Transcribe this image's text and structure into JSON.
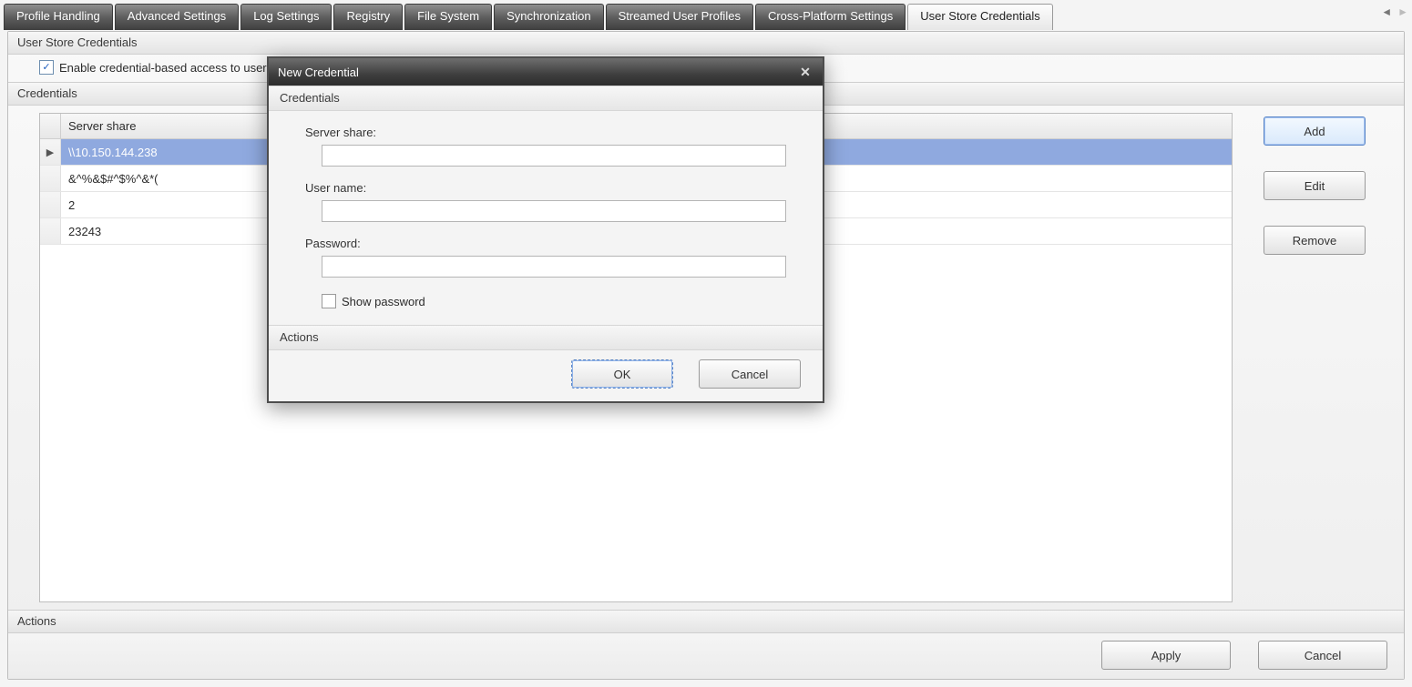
{
  "tabs": [
    {
      "label": "Profile Handling",
      "active": false
    },
    {
      "label": "Advanced Settings",
      "active": false
    },
    {
      "label": "Log Settings",
      "active": false
    },
    {
      "label": "Registry",
      "active": false
    },
    {
      "label": "File System",
      "active": false
    },
    {
      "label": "Synchronization",
      "active": false
    },
    {
      "label": "Streamed User Profiles",
      "active": false
    },
    {
      "label": "Cross-Platform Settings",
      "active": false
    },
    {
      "label": "User Store Credentials",
      "active": true
    }
  ],
  "panel": {
    "section1_title": "User Store Credentials",
    "enable_label": "Enable credential-based access to user store",
    "enable_checked": true,
    "section2_title": "Credentials",
    "grid_header": "Server share",
    "rows": [
      {
        "share": "\\\\10.150.144.238",
        "selected": true
      },
      {
        "share": "&^%&$#^$%^&*(",
        "selected": false
      },
      {
        "share": "2",
        "selected": false
      },
      {
        "share": "23243",
        "selected": false
      }
    ],
    "buttons": {
      "add": "Add",
      "edit": "Edit",
      "remove": "Remove"
    }
  },
  "actions": {
    "title": "Actions",
    "apply": "Apply",
    "cancel": "Cancel"
  },
  "dialog": {
    "title": "New Credential",
    "section_title": "Credentials",
    "server_share_label": "Server share:",
    "server_share_value": "",
    "user_name_label": "User name:",
    "user_name_value": "",
    "password_label": "Password:",
    "password_value": "",
    "show_password_label": "Show password",
    "show_password_checked": false,
    "actions_title": "Actions",
    "ok": "OK",
    "cancel": "Cancel"
  }
}
